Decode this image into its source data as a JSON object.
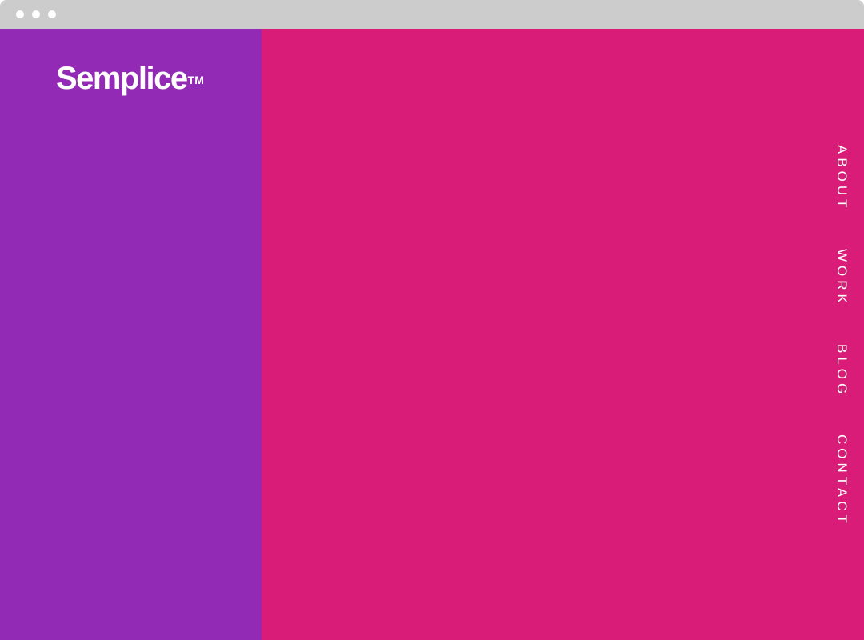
{
  "window": {
    "titlebar_color": "#cccccc",
    "controls": [
      "dot",
      "dot",
      "dot"
    ]
  },
  "brand": {
    "name": "Semplice",
    "trademark": "TM"
  },
  "colors": {
    "left_panel": "#932ab5",
    "right_panel": "#d91c78",
    "text": "#ffffff"
  },
  "nav": {
    "items": [
      {
        "label": "ABOUT"
      },
      {
        "label": "WORK"
      },
      {
        "label": "BLOG"
      },
      {
        "label": "CONTACT"
      }
    ]
  }
}
